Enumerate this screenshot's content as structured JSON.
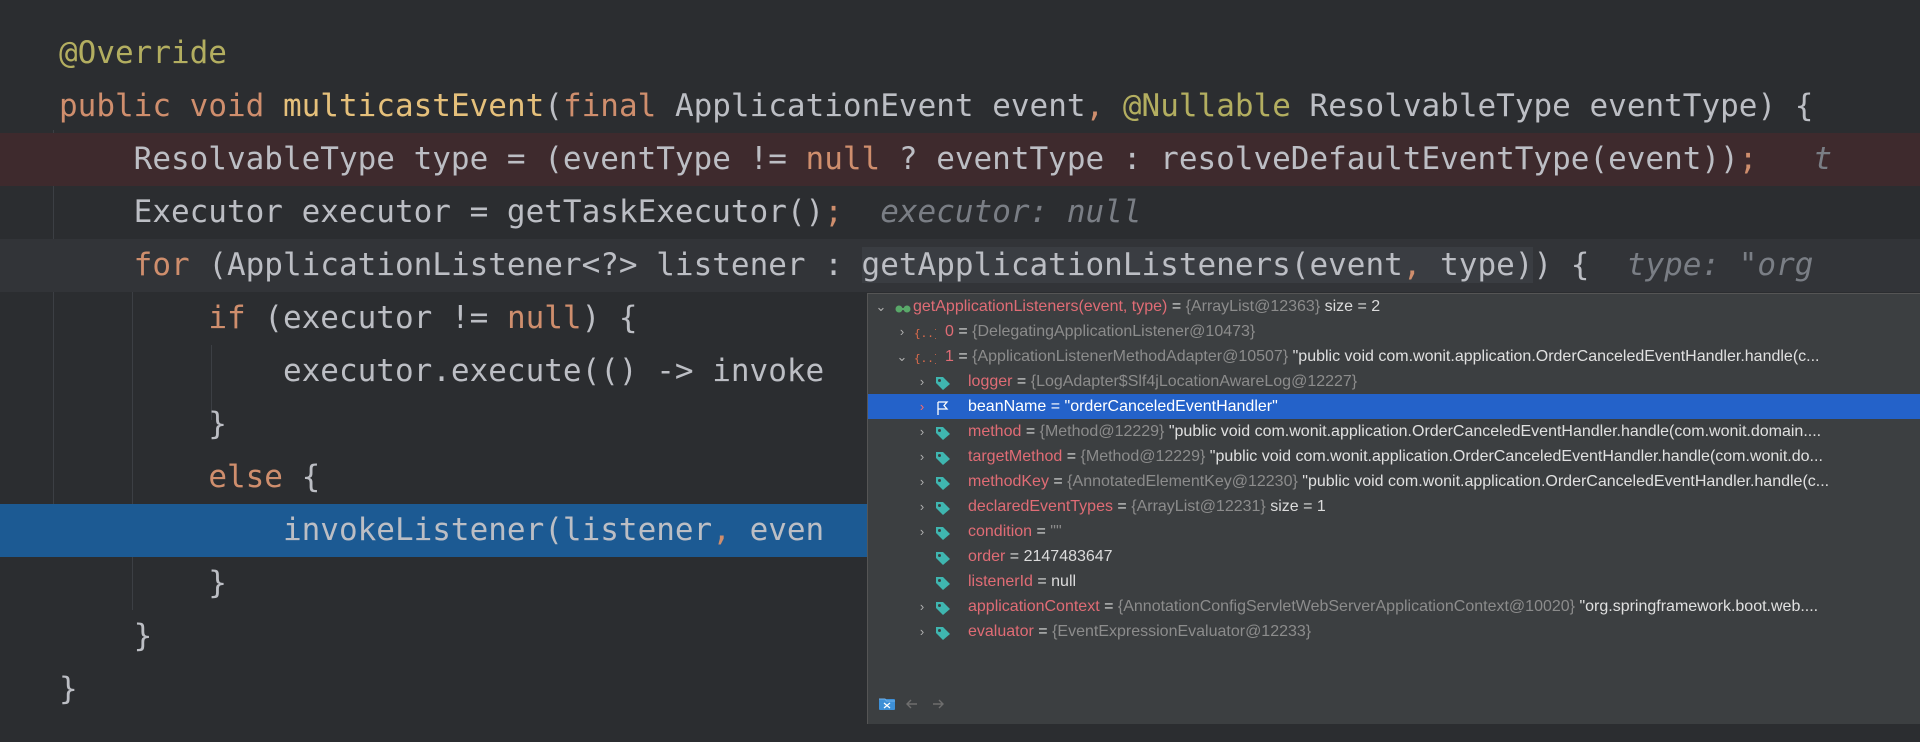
{
  "code": {
    "l1": {
      "t1": "@Override"
    },
    "l2": {
      "t1": "public",
      "t2": " ",
      "t3": "void",
      "t4": " ",
      "t5": "multicastEvent",
      "t6": "(",
      "t7": "final",
      "t8": " ApplicationEvent event",
      "t9": ",",
      "t10": " ",
      "t11": "@Nullable",
      "t12": " ResolvableType eventType) {"
    },
    "l3": {
      "t1": "    ResolvableType type = (eventType != ",
      "t2": "null",
      "t3": " ? eventType : resolveDefaultEventType(event))",
      "t4": ";",
      "t5": "   t"
    },
    "l4": {
      "t1": "    Executor executor = getTaskExecutor()",
      "t2": ";",
      "t3": "  executor: null"
    },
    "l5": {
      "t1": "    ",
      "t2": "for",
      "t3": " (ApplicationListener<?> listener : ",
      "t4": "getApplicationListeners(event",
      "t5": ",",
      "t6": " type)",
      "t7": ") {",
      "t8": "  type: \"org"
    },
    "l6": {
      "t1": "        ",
      "t2": "if",
      "t3": " (executor != ",
      "t4": "null",
      "t5": ") {"
    },
    "l7": {
      "t1": "            executor.execute(() -> invoke"
    },
    "l8": {
      "t1": "        }"
    },
    "l9": {
      "t1": "        ",
      "t2": "else",
      "t3": " {"
    },
    "l10": {
      "t1": "            invokeListener(listener",
      "t2": ",",
      "t3": " even"
    },
    "l11": {
      "t1": "        }"
    },
    "l12": {
      "t1": "    }"
    },
    "l13": {
      "t1": "}"
    }
  },
  "popup": {
    "root": {
      "name": "getApplicationListeners(event, type)",
      "eq": " = ",
      "ref": "{ArrayList@12363}",
      "extra": "  size = 2"
    },
    "i0": {
      "name": "0",
      "eq": " = ",
      "ref": "{DelegatingApplicationListener@10473}"
    },
    "i1": {
      "name": "1",
      "eq": " = ",
      "ref": "{ApplicationListenerMethodAdapter@10507}",
      "str": " \"public void com.wonit.application.OrderCanceledEventHandler.handle(c..."
    },
    "logger": {
      "name": "logger",
      "eq": " = ",
      "ref": "{LogAdapter$Slf4jLocationAwareLog@12227}"
    },
    "beanName": {
      "name": "beanName",
      "eq": " = ",
      "str": "\"orderCanceledEventHandler\""
    },
    "method": {
      "name": "method",
      "eq": " = ",
      "ref": "{Method@12229}",
      "str": " \"public void com.wonit.application.OrderCanceledEventHandler.handle(com.wonit.domain...."
    },
    "targetMethod": {
      "name": "targetMethod",
      "eq": " = ",
      "ref": "{Method@12229}",
      "str": " \"public void com.wonit.application.OrderCanceledEventHandler.handle(com.wonit.do..."
    },
    "methodKey": {
      "name": "methodKey",
      "eq": " = ",
      "ref": "{AnnotatedElementKey@12230}",
      "str": " \"public void com.wonit.application.OrderCanceledEventHandler.handle(c..."
    },
    "declaredEventTypes": {
      "name": "declaredEventTypes",
      "eq": " = ",
      "ref": "{ArrayList@12231}",
      "extra": "  size = 1"
    },
    "condition": {
      "name": "condition",
      "eq": " = ",
      "str": "\"\""
    },
    "order": {
      "name": "order",
      "eq": " = ",
      "plain": "2147483647"
    },
    "listenerId": {
      "name": "listenerId",
      "eq": " = ",
      "plain": "null"
    },
    "applicationContext": {
      "name": "applicationContext",
      "eq": " = ",
      "ref": "{AnnotationConfigServletWebServerApplicationContext@10020}",
      "str": " \"org.springframework.boot.web...."
    },
    "evaluator": {
      "name": "evaluator",
      "eq": " = ",
      "ref": "{EventExpressionEvaluator@12233}"
    }
  },
  "icons": {
    "expand": "chevron-right-icon",
    "collapse": "chevron-down-icon",
    "field": "field-tag-icon",
    "array": "array-icon",
    "watch": "watch-glasses-icon",
    "flag": "flag-icon",
    "back": "arrow-left-icon",
    "forward": "arrow-right-icon",
    "toolbar": "pin-to-tab-icon"
  },
  "colors": {
    "editor_bg": "#2b2d30",
    "keyword": "#cf8e6d",
    "annotation": "#b3ae60",
    "selection": "#2462c9",
    "execution_line": "#1c5a93",
    "breakpoint_line": "#3e2a2d",
    "field_name": "#e06c75"
  }
}
